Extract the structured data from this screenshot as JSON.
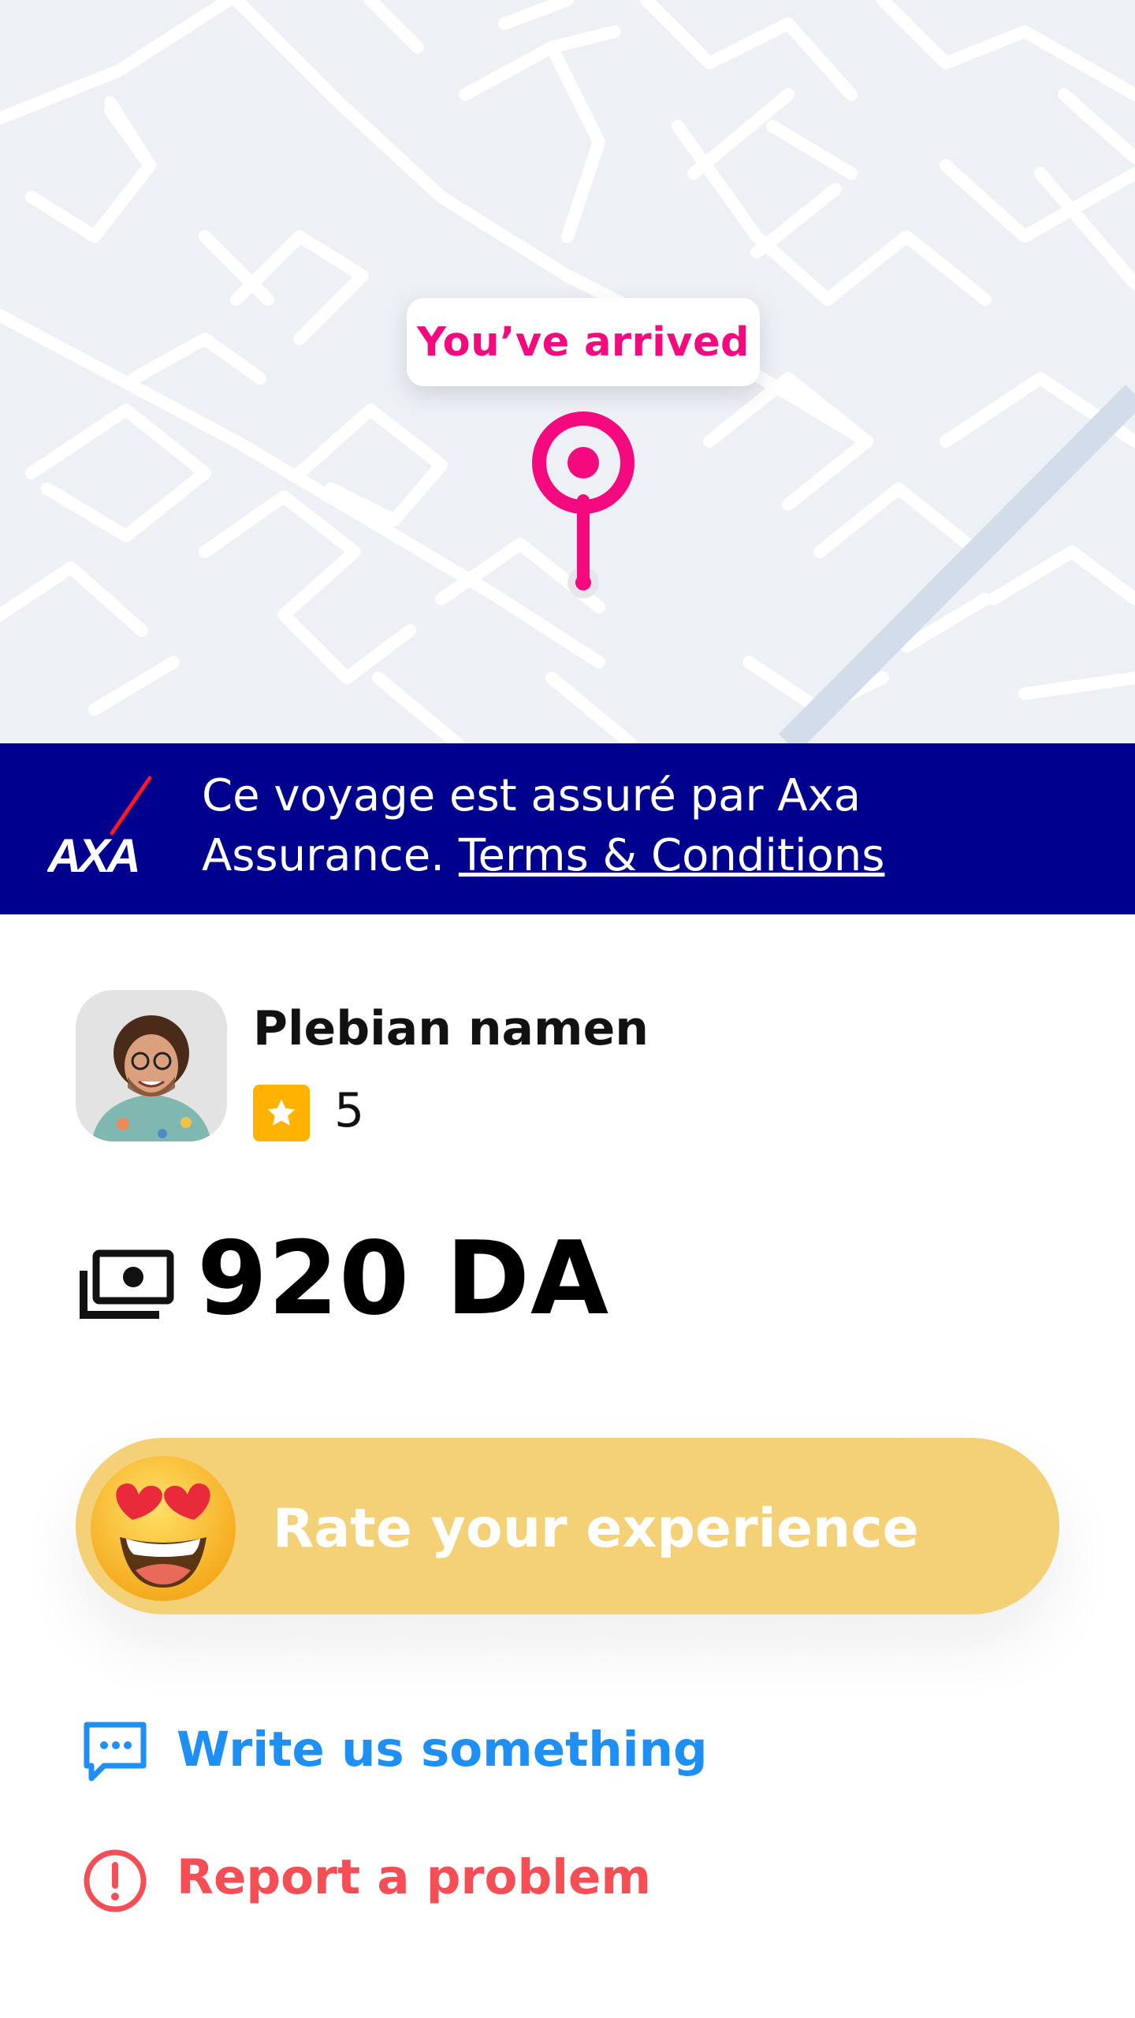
{
  "map": {
    "arrival_label": "You’ve arrived",
    "pin_color": "#f4097e"
  },
  "insurance_banner": {
    "logo_text": "AXA",
    "text": "Ce voyage est assuré par Axa Assurance.",
    "terms_link": "Terms & Conditions",
    "background_color": "#00008f"
  },
  "driver": {
    "name": "Plebian namen",
    "rating": "5",
    "rating_icon": "star-icon"
  },
  "fare": {
    "amount": "920 DA",
    "icon": "cash-icon"
  },
  "rate_button": {
    "label": "Rate your experience",
    "emoji": "heart-eyes-emoji",
    "color": "#f4d077"
  },
  "links": {
    "write": {
      "label": "Write us something",
      "icon": "chat-bubble-icon",
      "color": "#1e8ff5"
    },
    "report": {
      "label": "Report a problem",
      "icon": "alert-circle-icon",
      "color": "#f54e55"
    }
  }
}
